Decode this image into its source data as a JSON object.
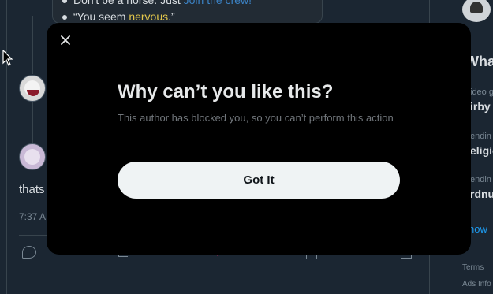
{
  "background": {
    "quote_items": [
      {
        "before": "Don't be a horse. Just ",
        "highlight": "Join the crew!"
      },
      {
        "before": "“You seem ",
        "highlight": "nervous",
        "after": ".”"
      }
    ],
    "post": {
      "text": "thats",
      "time": "7:37 A"
    },
    "sidebar": {
      "title": "Wha",
      "trends": [
        {
          "meta": "ideo g",
          "name": "irby"
        },
        {
          "meta": "endin",
          "name": "eligio"
        },
        {
          "meta": "endin",
          "name": "rdnu"
        }
      ],
      "show_more": "how",
      "footer": [
        "Terms",
        "Ads Info"
      ]
    }
  },
  "modal": {
    "title": "Why can’t you like this?",
    "body": "This author has blocked you, so you can’t perform this action",
    "button": "Got It"
  },
  "colors": {
    "modal_bg": "#000000",
    "button_bg": "#eff3f4",
    "like": "#e0245e",
    "link": "#1d9bf0"
  }
}
